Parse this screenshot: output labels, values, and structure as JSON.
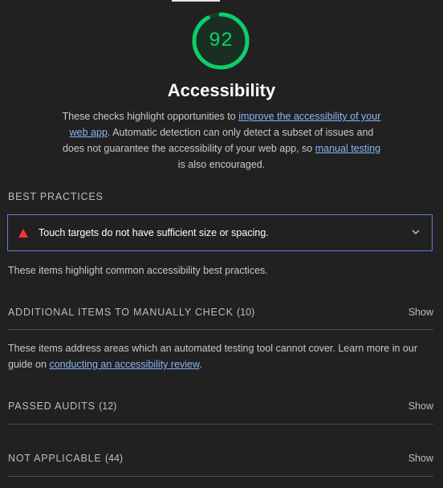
{
  "score": {
    "value": "92",
    "fraction": 0.92,
    "color": "#0cce6b"
  },
  "category": {
    "title": "Accessibility",
    "desc_part1": "These checks highlight opportunities to ",
    "desc_link1": "improve the accessibility of your web app",
    "desc_part2": ". Automatic detection can only detect a subset of issues and does not guarantee the accessibility of your web app, so ",
    "desc_link2": "manual testing",
    "desc_part3": " is also encouraged."
  },
  "best_practices": {
    "label": "BEST PRACTICES",
    "audit_title": "Touch targets do not have sufficient size or spacing.",
    "note": "These items highlight common accessibility best practices."
  },
  "manual": {
    "label": "ADDITIONAL ITEMS TO MANUALLY CHECK",
    "count": "(10)",
    "show": "Show",
    "note_part1": "These items address areas which an automated testing tool cannot cover. Learn more in our guide on ",
    "note_link": "conducting an accessibility review",
    "note_part2": "."
  },
  "passed": {
    "label": "PASSED AUDITS",
    "count": "(12)",
    "show": "Show"
  },
  "not_applicable": {
    "label": "NOT APPLICABLE",
    "count": "(44)",
    "show": "Show"
  },
  "icons": {
    "warning": "warning-triangle-icon",
    "expand": "chevron-down-icon"
  },
  "colors": {
    "accent_link": "#8ab4f8",
    "warning": "#ff3333",
    "focus_border": "#5e79e6"
  }
}
